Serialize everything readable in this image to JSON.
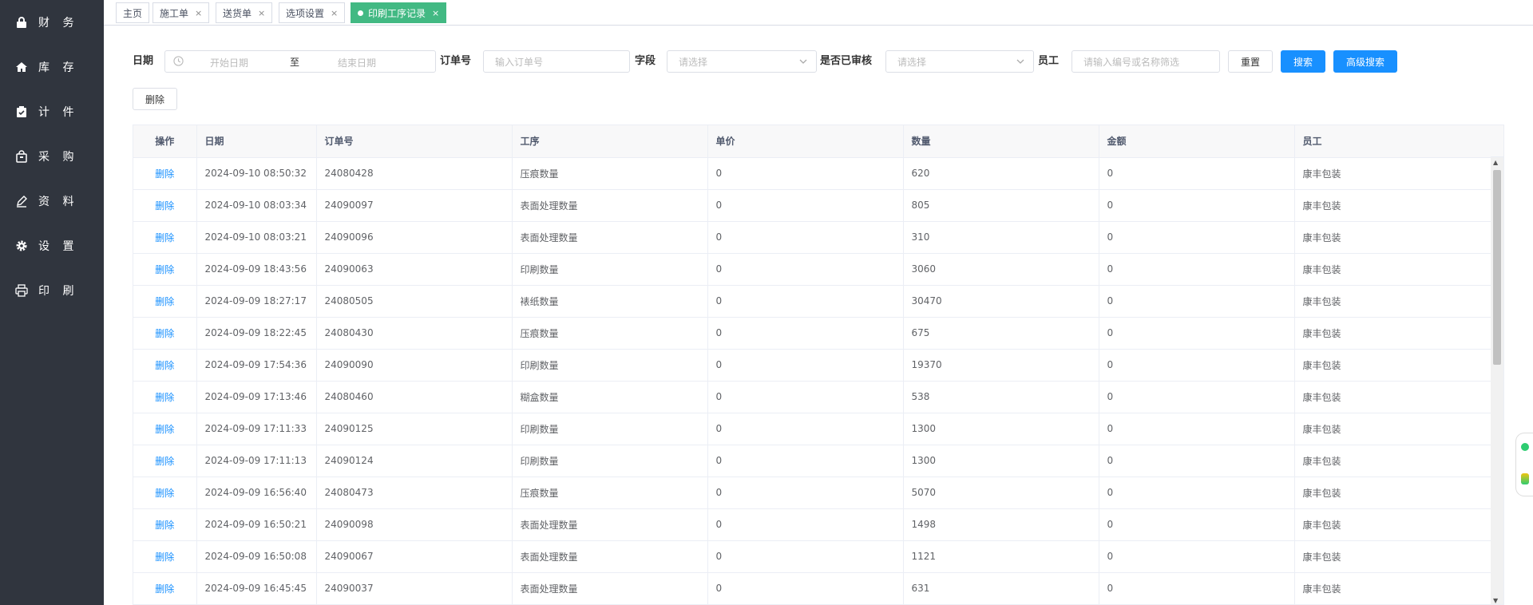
{
  "sidebar": {
    "items": [
      {
        "label": "财 务",
        "icon": "lock-icon"
      },
      {
        "label": "库 存",
        "icon": "home-icon"
      },
      {
        "label": "计 件",
        "icon": "clipboard-icon"
      },
      {
        "label": "采 购",
        "icon": "bag-icon"
      },
      {
        "label": "资 料",
        "icon": "edit-icon"
      },
      {
        "label": "设 置",
        "icon": "gear-icon"
      },
      {
        "label": "印 刷",
        "icon": "printer-icon"
      }
    ]
  },
  "tabs": [
    {
      "label": "主页",
      "closable": false
    },
    {
      "label": "施工单",
      "closable": true
    },
    {
      "label": "送货单",
      "closable": true
    },
    {
      "label": "选项设置",
      "closable": true
    },
    {
      "label": "印刷工序记录",
      "closable": true,
      "active": true
    }
  ],
  "tab_close": "×",
  "filters": {
    "date_label": "日期",
    "start_placeholder": "开始日期",
    "range_separator": "至",
    "end_placeholder": "结束日期",
    "order_label": "订单号",
    "order_placeholder": "输入订单号",
    "field_label": "字段",
    "field_placeholder": "请选择",
    "audited_label": "是否已审核",
    "audited_placeholder": "请选择",
    "employee_label": "员工",
    "employee_placeholder": "请输入编号或名称筛选",
    "reset_button": "重置",
    "search_button": "搜索",
    "advanced_button": "高级搜索"
  },
  "delete_button": "删除",
  "table": {
    "columns": [
      "操作",
      "日期",
      "订单号",
      "工序",
      "单价",
      "数量",
      "金额",
      "员工"
    ],
    "row_action": "删除",
    "rows": [
      [
        "2024-09-10 08:50:32",
        "24080428",
        "压痕数量",
        "0",
        "620",
        "0",
        "康丰包装"
      ],
      [
        "2024-09-10 08:03:34",
        "24090097",
        "表面处理数量",
        "0",
        "805",
        "0",
        "康丰包装"
      ],
      [
        "2024-09-10 08:03:21",
        "24090096",
        "表面处理数量",
        "0",
        "310",
        "0",
        "康丰包装"
      ],
      [
        "2024-09-09 18:43:56",
        "24090063",
        "印刷数量",
        "0",
        "3060",
        "0",
        "康丰包装"
      ],
      [
        "2024-09-09 18:27:17",
        "24080505",
        "裱纸数量",
        "0",
        "30470",
        "0",
        "康丰包装"
      ],
      [
        "2024-09-09 18:22:45",
        "24080430",
        "压痕数量",
        "0",
        "675",
        "0",
        "康丰包装"
      ],
      [
        "2024-09-09 17:54:36",
        "24090090",
        "印刷数量",
        "0",
        "19370",
        "0",
        "康丰包装"
      ],
      [
        "2024-09-09 17:13:46",
        "24080460",
        "糊盒数量",
        "0",
        "538",
        "0",
        "康丰包装"
      ],
      [
        "2024-09-09 17:11:33",
        "24090125",
        "印刷数量",
        "0",
        "1300",
        "0",
        "康丰包装"
      ],
      [
        "2024-09-09 17:11:13",
        "24090124",
        "印刷数量",
        "0",
        "1300",
        "0",
        "康丰包装"
      ],
      [
        "2024-09-09 16:56:40",
        "24080473",
        "压痕数量",
        "0",
        "5070",
        "0",
        "康丰包装"
      ],
      [
        "2024-09-09 16:50:21",
        "24090098",
        "表面处理数量",
        "0",
        "1498",
        "0",
        "康丰包装"
      ],
      [
        "2024-09-09 16:50:08",
        "24090067",
        "表面处理数量",
        "0",
        "1121",
        "0",
        "康丰包装"
      ],
      [
        "2024-09-09 16:45:45",
        "24090037",
        "表面处理数量",
        "0",
        "631",
        "0",
        "康丰包装"
      ]
    ]
  },
  "colors": {
    "sidebar_bg": "#30353e",
    "active_tab": "#42b983",
    "primary": "#1890ff"
  }
}
